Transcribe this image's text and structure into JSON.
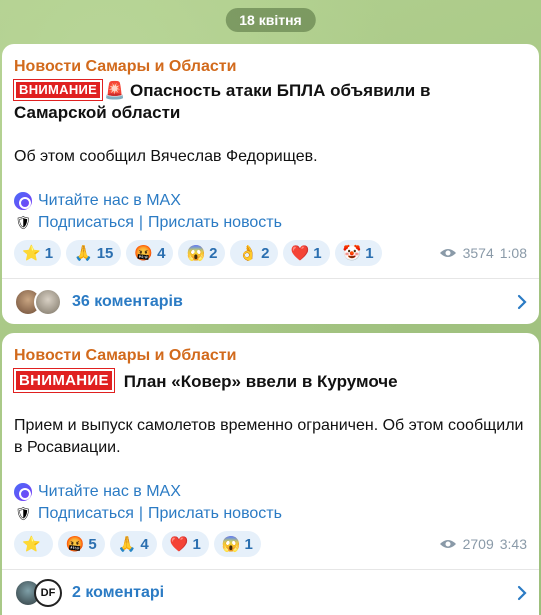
{
  "date_pill": "18 квітня",
  "messages": [
    {
      "channel": "Новости Самары и Области",
      "tag": "ВНИМАНИЕ",
      "tag_icon": "🚨",
      "headline": "Опасность атаки БПЛА объявили в Самарской области",
      "text": "Об этом сообщил Вячеслав Федорищев.",
      "link_max": "Читайте нас в MAX",
      "link_subscribe": "Подписаться",
      "link_sep": "|",
      "link_news": "Прислать новость",
      "reactions": [
        {
          "emoji": "⭐",
          "count": "1"
        },
        {
          "emoji": "🙏",
          "count": "15"
        },
        {
          "emoji": "🤬",
          "count": "4"
        },
        {
          "emoji": "😱",
          "count": "2"
        },
        {
          "emoji": "👌",
          "count": "2"
        },
        {
          "emoji": "❤️",
          "count": "1"
        },
        {
          "emoji": "🤡",
          "count": "1"
        }
      ],
      "views": "3574",
      "time": "1:08",
      "comments": "36 коментарів"
    },
    {
      "channel": "Новости Самары и Области",
      "tag": "ВНИМАНИЕ",
      "headline": "План «Ковер» ввели в Курумоче",
      "text": "Прием и выпуск самолетов временно ограничен. Об этом сообщили в Росавиации.",
      "link_max": "Читайте нас в MAX",
      "link_subscribe": "Подписаться",
      "link_sep": "|",
      "link_news": "Прислать новость",
      "reactions": [
        {
          "emoji": "⭐",
          "count": ""
        },
        {
          "emoji": "🤬",
          "count": "5"
        },
        {
          "emoji": "🙏",
          "count": "4"
        },
        {
          "emoji": "❤️",
          "count": "1"
        },
        {
          "emoji": "😱",
          "count": "1"
        }
      ],
      "views": "2709",
      "time": "3:43",
      "comments": "2 коментарі",
      "avatar2_text": "DF"
    }
  ],
  "colors": {
    "channel": "#d26a1c",
    "link": "#2b7bc4",
    "tag": "#e02020"
  }
}
